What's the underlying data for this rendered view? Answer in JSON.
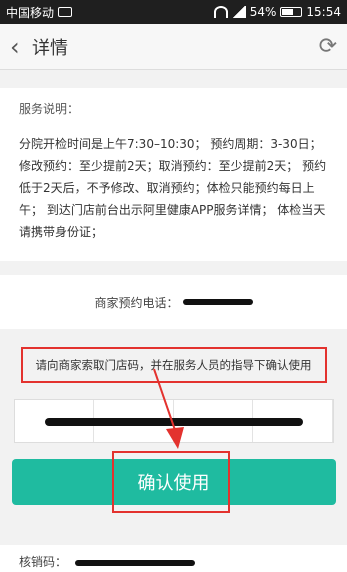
{
  "statusbar": {
    "carrier": "中国移动",
    "battery": "54%",
    "time": "15:54",
    "network": "4G"
  },
  "header": {
    "title": "详情"
  },
  "service": {
    "title": "服务说明：",
    "body": "分院开检时间是上午7:30–10:30； 预约周期：3-30日； 修改预约：至少提前2天；取消预约：至少提前2天； 预约低于2天后，不予修改、取消预约；体检只能预约每日上午； 到达门店前台出示阿里健康APP服务详情； 体检当天请携带身份证；"
  },
  "phone": {
    "label": "商家预约电话："
  },
  "instruction": {
    "text": "请向商家索取门店码，并在服务人员的指导下确认使用"
  },
  "actions": {
    "confirm_label": "确认使用"
  },
  "footer": {
    "code_label": "核销码："
  },
  "colors": {
    "accent": "#1fbba0",
    "highlight": "#e3322e"
  }
}
